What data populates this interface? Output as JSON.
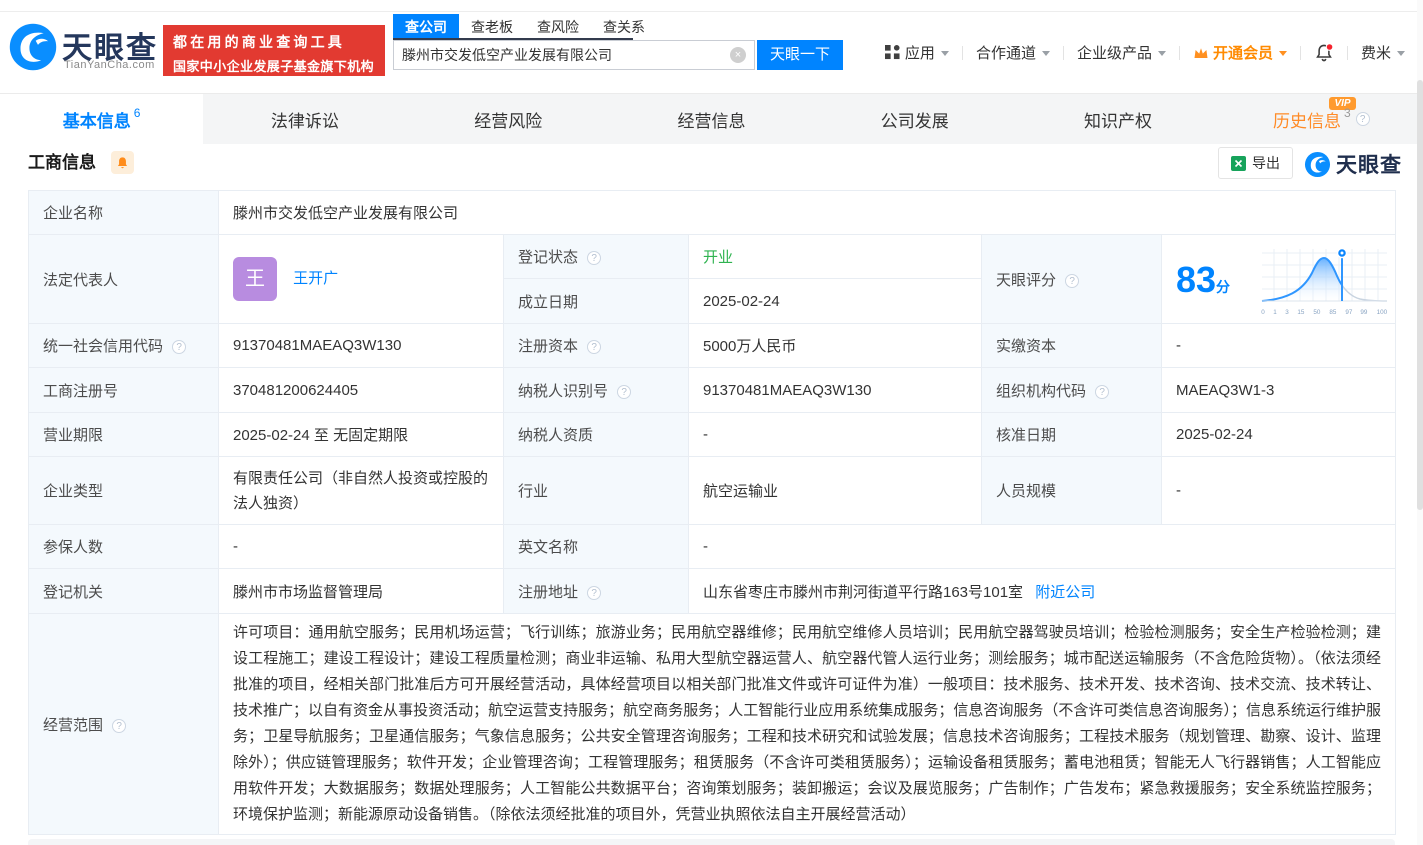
{
  "icons": {
    "question_mark": "?",
    "clear": "×",
    "vip": "VIP"
  },
  "header": {
    "brand": "天眼查",
    "brand_domain": "TianYanCha.com",
    "slogan_line1": "都在用的商业查询工具",
    "slogan_line2": "国家中小企业发展子基金旗下机构",
    "search_tabs": [
      {
        "label": "查公司"
      },
      {
        "label": "查老板"
      },
      {
        "label": "查风险"
      },
      {
        "label": "查关系"
      }
    ],
    "search_value": "滕州市交发低空产业发展有限公司",
    "search_button": "天眼一下",
    "nav_app": "应用",
    "nav_coop": "合作通道",
    "nav_enterprise": "企业级产品",
    "nav_vip": "开通会员",
    "nav_user": "费米"
  },
  "tabs": {
    "basic": "基本信息",
    "basic_count": "6",
    "legal": "法律诉讼",
    "risk": "经营风险",
    "operation": "经营信息",
    "development": "公司发展",
    "ip": "知识产权",
    "history": "历史信息",
    "history_count": "3"
  },
  "section": {
    "title": "工商信息",
    "export": "导出",
    "brand": "天眼查"
  },
  "fields": {
    "company_name_label": "企业名称",
    "company_name": "滕州市交发低空产业发展有限公司",
    "legal_rep_label": "法定代表人",
    "legal_rep_avatar": "王",
    "legal_rep_name": "王开广",
    "reg_status_label": "登记状态",
    "reg_status_value": "开业",
    "establish_label": "成立日期",
    "establish_value": "2025-02-24",
    "score_label": "天眼评分",
    "score_value": "83",
    "score_unit": "分",
    "uscc_label": "统一社会信用代码",
    "uscc_value": "91370481MAEAQ3W130",
    "reg_capital_label": "注册资本",
    "reg_capital_value": "5000万人民币",
    "paid_capital_label": "实缴资本",
    "paid_capital_value": "-",
    "reg_no_label": "工商注册号",
    "reg_no_value": "370481200624405",
    "taxpayer_id_label": "纳税人识别号",
    "taxpayer_id_value": "91370481MAEAQ3W130",
    "org_code_label": "组织机构代码",
    "org_code_value": "MAEAQ3W1-3",
    "term_label": "营业期限",
    "term_value": "2025-02-24 至 无固定期限",
    "taxpayer_qual_label": "纳税人资质",
    "taxpayer_qual_value": "-",
    "approve_date_label": "核准日期",
    "approve_date_value": "2025-02-24",
    "company_type_label": "企业类型",
    "company_type_value": "有限责任公司（非自然人投资或控股的法人独资）",
    "industry_label": "行业",
    "industry_value": "航空运输业",
    "staff_size_label": "人员规模",
    "staff_size_value": "-",
    "insured_label": "参保人数",
    "insured_value": "-",
    "english_name_label": "英文名称",
    "english_name_value": "-",
    "reg_authority_label": "登记机关",
    "reg_authority_value": "滕州市市场监督管理局",
    "address_label": "注册地址",
    "address_value": "山东省枣庄市滕州市荆河街道平行路163号101室",
    "address_link": "附近公司",
    "scope_label": "经营范围",
    "scope_value": "许可项目：通用航空服务；民用机场运营；飞行训练；旅游业务；民用航空器维修；民用航空维修人员培训；民用航空器驾驶员培训；检验检测服务；安全生产检验检测；建设工程施工；建设工程设计；建设工程质量检测；商业非运输、私用大型航空器运营人、航空器代管人运行业务；测绘服务；城市配送运输服务（不含危险货物）。（依法须经批准的项目，经相关部门批准后方可开展经营活动，具体经营项目以相关部门批准文件或许可证件为准）一般项目：技术服务、技术开发、技术咨询、技术交流、技术转让、技术推广；以自有资金从事投资活动；航空运营支持服务；航空商务服务；人工智能行业应用系统集成服务；信息咨询服务（不含许可类信息咨询服务）；信息系统运行维护服务；卫星导航服务；卫星通信服务；气象信息服务；公共安全管理咨询服务；工程和技术研究和试验发展；信息技术咨询服务；工程技术服务（规划管理、勘察、设计、监理除外）；供应链管理服务；软件开发；企业管理咨询；工程管理服务；租赁服务（不含许可类租赁服务）；运输设备租赁服务；蓄电池租赁；智能无人飞行器销售；人工智能应用软件开发；大数据服务；数据处理服务；人工智能公共数据平台；咨询策划服务；装卸搬运；会议及展览服务；广告制作；广告发布；紧急救援服务；安全系统监控服务；环境保护监测；新能源原动设备销售。（除依法须经批准的项目外，凭营业执照依法自主开展经营活动）"
  },
  "chart_data": {
    "type": "area",
    "title": "天眼评分",
    "score": 83,
    "unit": "分",
    "x_labels": [
      "0",
      "1",
      "3",
      "15",
      "50",
      "85",
      "97",
      "99",
      "100"
    ],
    "marker_at_label": "85",
    "curve": "bell",
    "accent_color": "#0084ff"
  }
}
